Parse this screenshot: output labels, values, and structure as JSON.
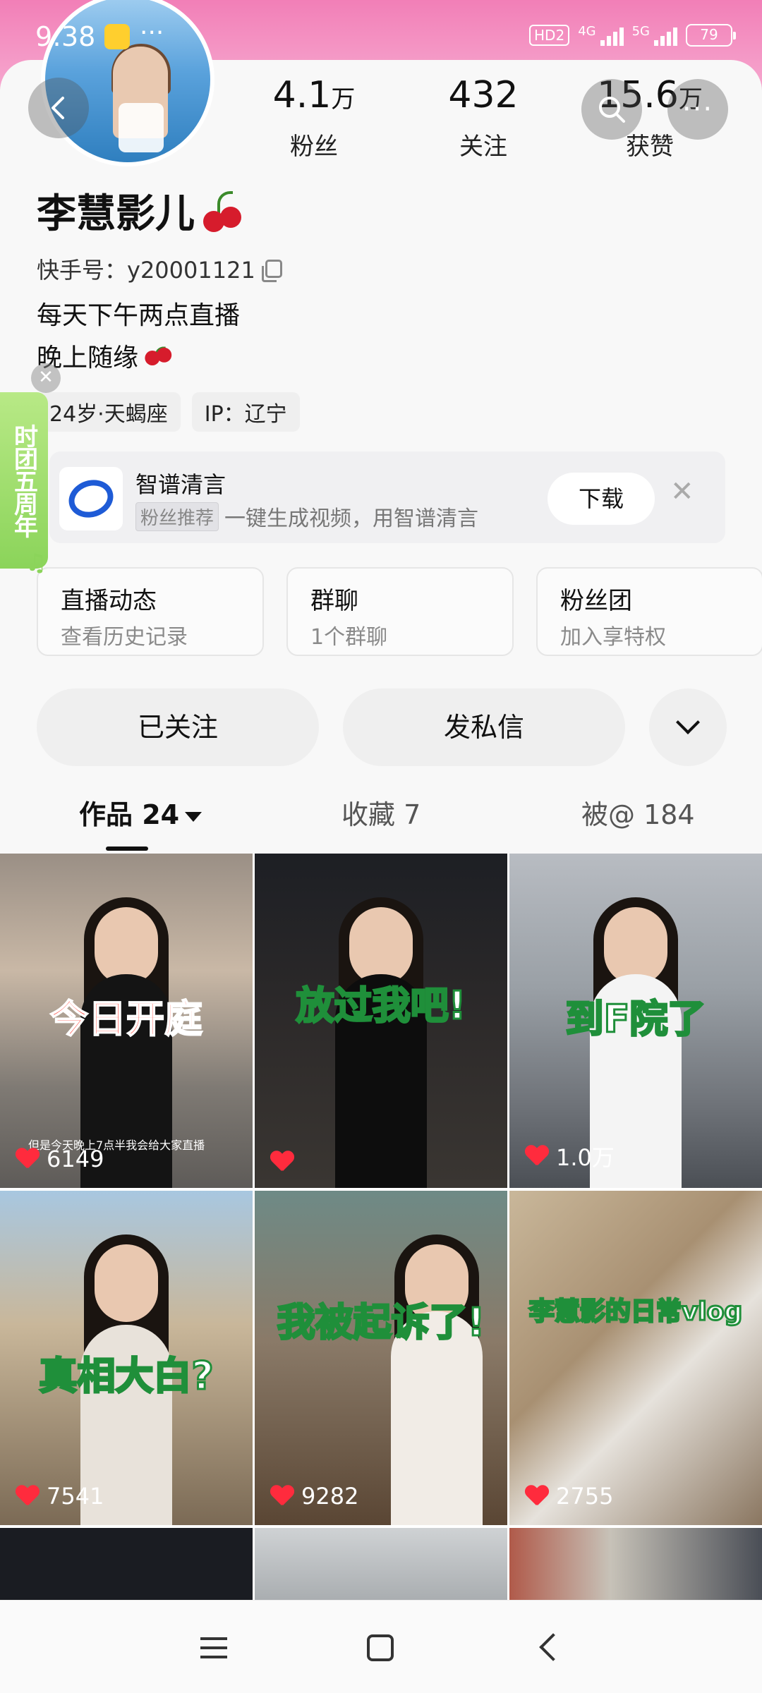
{
  "status_bar": {
    "time": "9:38",
    "overflow": "···",
    "hd": "HD2",
    "net1": "4G",
    "net2": "5G",
    "battery": "79"
  },
  "profile": {
    "name": "李慧影儿",
    "kuaishou_id": "快手号：y20001121",
    "bio_line1": "每天下午两点直播",
    "bio_line2": "晚上随缘",
    "tag_age": "24岁·天蝎座",
    "tag_ip": "IP：辽宁"
  },
  "stats": [
    {
      "num": "4.1",
      "unit": "万",
      "label": "粉丝"
    },
    {
      "num": "432",
      "unit": "",
      "label": "关注"
    },
    {
      "num": "15.6",
      "unit": "万",
      "label": "获赞"
    }
  ],
  "floating_badge": {
    "text": "时团五周年",
    "close": "✕",
    "note": "♫"
  },
  "ad": {
    "title": "智谱清言",
    "badge": "粉丝推荐",
    "text": "一键生成视频，用智谱清言",
    "button": "下载",
    "close": "✕"
  },
  "features": [
    {
      "title": "直播动态",
      "sub": "查看历史记录"
    },
    {
      "title": "群聊",
      "sub": "1个群聊"
    },
    {
      "title": "粉丝团",
      "sub": "加入享特权"
    }
  ],
  "actions": {
    "follow": "已关注",
    "message": "发私信"
  },
  "tabs": [
    {
      "label": "作品 24"
    },
    {
      "label": "收藏 7"
    },
    {
      "label": "被@ 184"
    }
  ],
  "videos": [
    {
      "caption": "今日开庭",
      "likes": "6149",
      "sub": "但是今天晚上7点半我会给大家直播"
    },
    {
      "caption": "放过我吧!",
      "likes": ""
    },
    {
      "caption": "到F院了",
      "likes": "1.0万"
    },
    {
      "caption": "真相大白?",
      "likes": "7541"
    },
    {
      "caption": "我被起诉了!",
      "likes": "9282"
    },
    {
      "caption": "李慧影的日常vlog",
      "likes": "2755"
    }
  ],
  "colors": {
    "accent_pink": "#f27fb7",
    "heart": "#ff2b3d",
    "ad_blue": "#1e5bd6"
  }
}
